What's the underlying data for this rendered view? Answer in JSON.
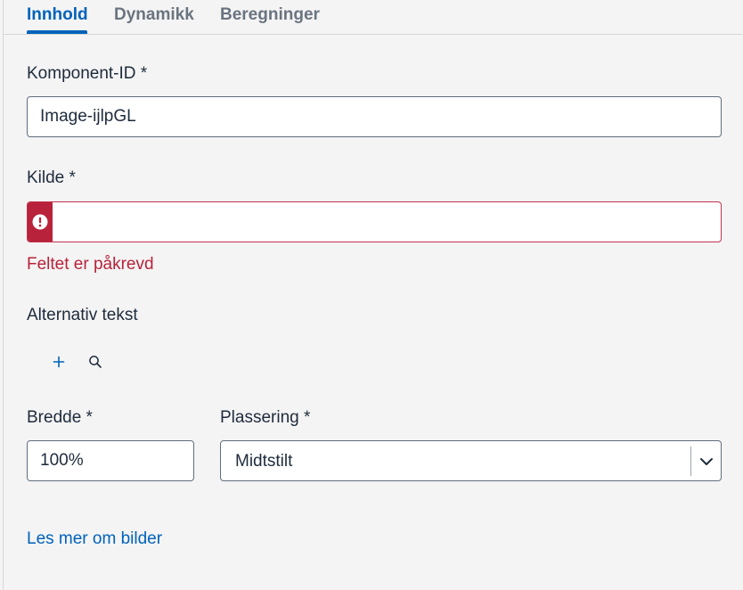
{
  "tabs": [
    {
      "label": "Innhold",
      "active": true
    },
    {
      "label": "Dynamikk",
      "active": false
    },
    {
      "label": "Beregninger",
      "active": false
    }
  ],
  "fields": {
    "component_id": {
      "label": "Komponent-ID *",
      "value": "Image-ijlpGL"
    },
    "source": {
      "label": "Kilde *",
      "value": "",
      "error": "Feltet er påkrevd",
      "error_icon": "exclamation-circle-icon"
    },
    "alt_text": {
      "label": "Alternativ tekst",
      "add_icon": "plus-icon",
      "search_icon": "search-icon"
    },
    "width": {
      "label": "Bredde *",
      "value": "100%"
    },
    "placement": {
      "label": "Plassering *",
      "value": "Midtstilt",
      "chevron_icon": "chevron-down-icon"
    }
  },
  "link": {
    "label": "Les mer om bilder"
  },
  "colors": {
    "accent": "#0062ba",
    "error": "#b8223a",
    "text": "#1e2b3c",
    "muted_tab": "#6a7480",
    "background": "#f4f4f4"
  }
}
